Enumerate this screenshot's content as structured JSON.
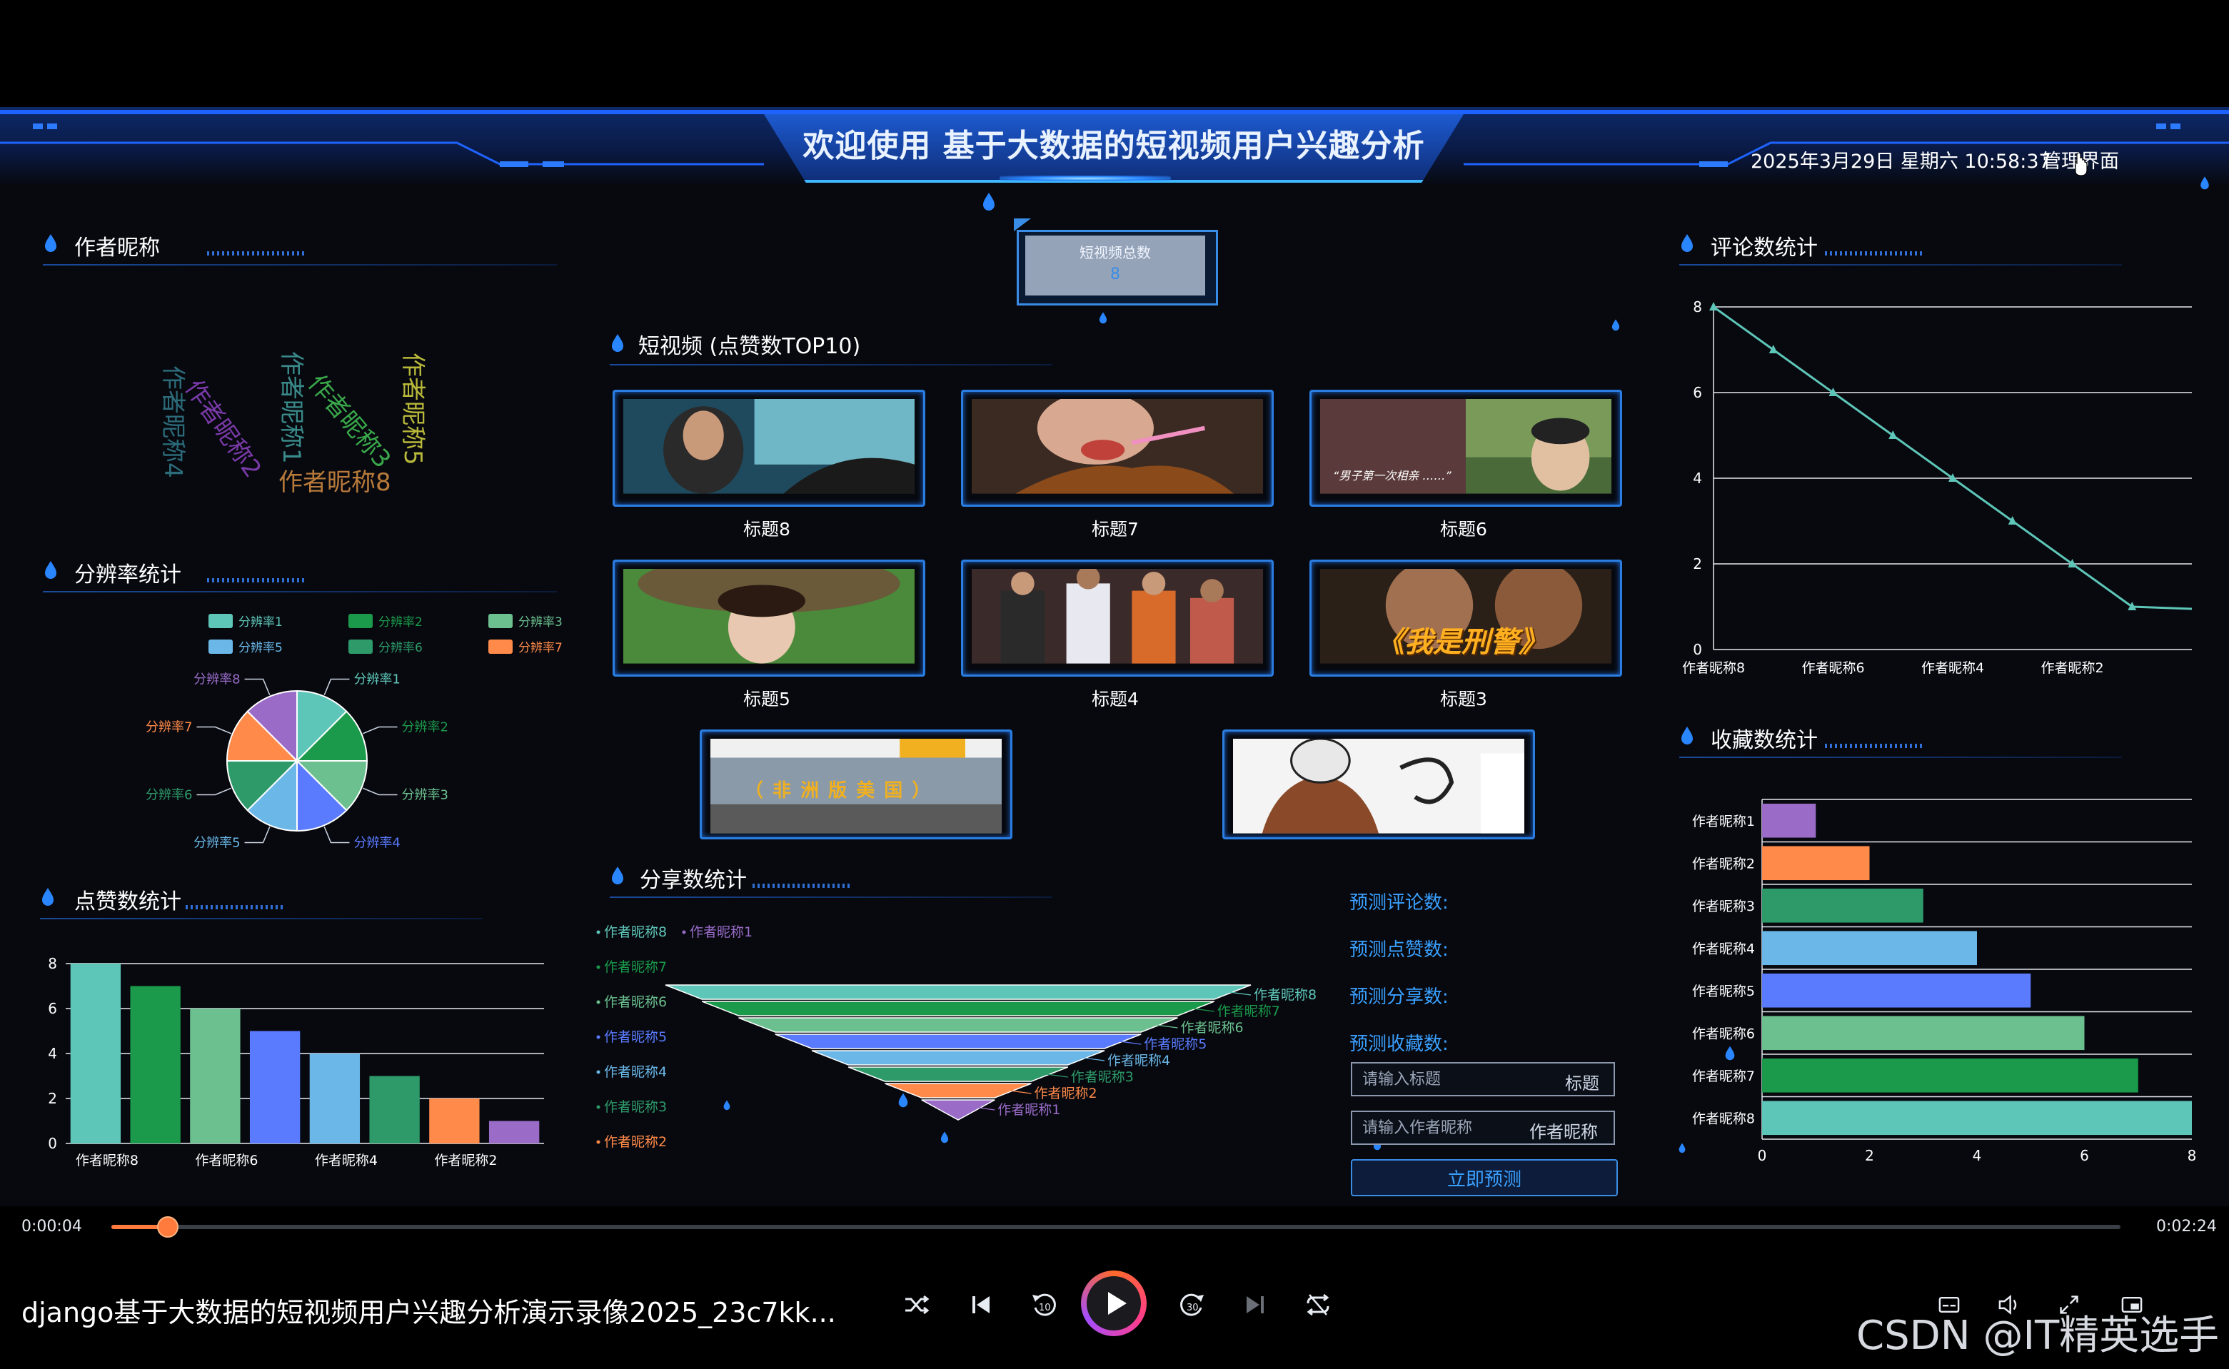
{
  "header": {
    "title": "欢迎使用 基于大数据的短视频用户兴趣分析",
    "datetime": "2025年3月29日 星期六 10:58:37",
    "admin_link": "管理界面"
  },
  "colors": {
    "accent": "#3a8de6",
    "teal": "#5ec6b8",
    "green": "#1a9a4a",
    "lightgreen": "#6cc08f",
    "blue": "#5b7bff",
    "skyblue": "#6bb8e8",
    "darkgreen": "#2e9a6a",
    "orange": "#ff8a4a",
    "purple": "#9a6cc8"
  },
  "author_section": {
    "title": "作者昵称",
    "words": [
      {
        "text": "作者昵称4",
        "color": "#2c6b7a"
      },
      {
        "text": "作者昵称2",
        "color": "#7a3aa8"
      },
      {
        "text": "作者昵称1",
        "color": "#3a8a8a"
      },
      {
        "text": "作者昵称3",
        "color": "#3aa84a"
      },
      {
        "text": "作者昵称5",
        "color": "#b8b83a"
      },
      {
        "text": "作者昵称8",
        "color": "#b87a3a"
      }
    ]
  },
  "resolution_section": {
    "title": "分辨率统计",
    "legend": [
      "分辨率1",
      "分辨率2",
      "分辨率3",
      "分辨率4",
      "分辨率5",
      "分辨率6",
      "分辨率7",
      "分辨率8"
    ]
  },
  "likes_section": {
    "title": "点赞数统计"
  },
  "video_section": {
    "title": "短视频 (点赞数TOP10)",
    "total_label": "短视频总数",
    "total_value": "8",
    "videos": [
      {
        "caption": "标题8",
        "scene": "car"
      },
      {
        "caption": "标题7",
        "scene": "noodles"
      },
      {
        "caption": "标题6",
        "scene": "child",
        "overlay": "“男子第一次相亲 ……”"
      },
      {
        "caption": "标题5",
        "scene": "woman"
      },
      {
        "caption": "标题4",
        "scene": "basketball"
      },
      {
        "caption": "标题3",
        "scene": "police",
        "overlay": "《我是刑警》"
      },
      {
        "caption": "",
        "scene": "desert",
        "overlay": "（ 非 洲 版 美 国 ）"
      },
      {
        "caption": "",
        "scene": "cartoon"
      }
    ]
  },
  "share_section": {
    "title": "分享数统计"
  },
  "prediction": {
    "labels": [
      "预测评论数:",
      "预测点赞数:",
      "预测分享数:",
      "预测收藏数:"
    ],
    "title_placeholder": "请输入标题",
    "title_suffix": "标题",
    "author_placeholder": "请输入作者昵称",
    "author_suffix": "作者昵称",
    "button": "立即预测"
  },
  "comments_section": {
    "title": "评论数统计"
  },
  "favorites_section": {
    "title": "收藏数统计"
  },
  "chart_data": [
    {
      "type": "pie",
      "id": "resolution",
      "categories": [
        "分辨率1",
        "分辨率2",
        "分辨率3",
        "分辨率4",
        "分辨率5",
        "分辨率6",
        "分辨率7",
        "分辨率8"
      ],
      "values": [
        1,
        1,
        1,
        1,
        1,
        1,
        1,
        1
      ],
      "legend": "top",
      "colors": [
        "#5ec6b8",
        "#1a9a4a",
        "#6cc08f",
        "#5b7bff",
        "#6bb8e8",
        "#2e9a6a",
        "#ff8a4a",
        "#9a6cc8"
      ]
    },
    {
      "type": "bar",
      "id": "likes",
      "categories": [
        "作者昵称8",
        "作者昵称7",
        "作者昵称6",
        "作者昵称5",
        "作者昵称4",
        "作者昵称3",
        "作者昵称2",
        "作者昵称1"
      ],
      "values": [
        8,
        7,
        6,
        5,
        4,
        3,
        2,
        1
      ],
      "xtick_labels": [
        "作者昵称8",
        "作者昵称6",
        "作者昵称4",
        "作者昵称2"
      ],
      "ylim": [
        0,
        8
      ],
      "yticks": [
        0,
        2,
        4,
        6,
        8
      ],
      "grid": true,
      "colors": [
        "#5ec6b8",
        "#1a9a4a",
        "#6cc08f",
        "#5b7bff",
        "#6bb8e8",
        "#2e9a6a",
        "#ff8a4a",
        "#9a6cc8"
      ]
    },
    {
      "type": "funnel",
      "id": "shares",
      "categories": [
        "作者昵称8",
        "作者昵称7",
        "作者昵称6",
        "作者昵称5",
        "作者昵称4",
        "作者昵称3",
        "作者昵称2",
        "作者昵称1"
      ],
      "values": [
        8,
        7,
        6,
        5,
        4,
        3,
        2,
        1
      ],
      "legend_order": [
        "作者昵称8",
        "作者昵称1",
        "作者昵称7",
        "作者昵称6",
        "作者昵称5",
        "作者昵称4",
        "作者昵称3",
        "作者昵称2"
      ],
      "colors": [
        "#5ec6b8",
        "#1a9a4a",
        "#6cc08f",
        "#5b7bff",
        "#6bb8e8",
        "#2e9a6a",
        "#ff8a4a",
        "#9a6cc8"
      ]
    },
    {
      "type": "line",
      "id": "comments",
      "categories": [
        "作者昵称8",
        "作者昵称7",
        "作者昵称6",
        "作者昵称5",
        "作者昵称4",
        "作者昵称3",
        "作者昵称2",
        "作者昵称1"
      ],
      "values": [
        8,
        7,
        6,
        5,
        4,
        3,
        2,
        1
      ],
      "xtick_labels": [
        "作者昵称8",
        "作者昵称6",
        "作者昵称4",
        "作者昵称2"
      ],
      "ylim": [
        0,
        8
      ],
      "yticks": [
        0,
        2,
        4,
        6,
        8
      ],
      "grid": true,
      "color": "#5ec6b8"
    },
    {
      "type": "bar",
      "orientation": "horizontal",
      "id": "favorites",
      "categories": [
        "作者昵称1",
        "作者昵称2",
        "作者昵称3",
        "作者昵称4",
        "作者昵称5",
        "作者昵称6",
        "作者昵称7",
        "作者昵称8"
      ],
      "values": [
        1,
        2,
        3,
        4,
        5,
        6,
        7,
        8
      ],
      "xlim": [
        0,
        8
      ],
      "xticks": [
        0,
        2,
        4,
        6,
        8
      ],
      "grid": true,
      "colors": [
        "#9a6cc8",
        "#ff8a4a",
        "#2e9a6a",
        "#6bb8e8",
        "#5b7bff",
        "#6cc08f",
        "#1a9a4a",
        "#5ec6b8"
      ]
    }
  ],
  "player": {
    "current_time": "0:00:04",
    "duration": "0:02:24",
    "progress": 0.028,
    "video_title": "django基于大数据的短视频用户兴趣分析演示录像2025_23c7kk...",
    "controls": [
      "shuffle-icon",
      "previous-icon",
      "rewind-10-icon",
      "play-icon",
      "forward-30-icon",
      "next-icon",
      "repeat-icon"
    ],
    "right_controls": [
      "subtitles-icon",
      "volume-icon",
      "fullscreen-icon",
      "miniplayer-icon"
    ]
  },
  "watermark": "CSDN @IT精英选手"
}
